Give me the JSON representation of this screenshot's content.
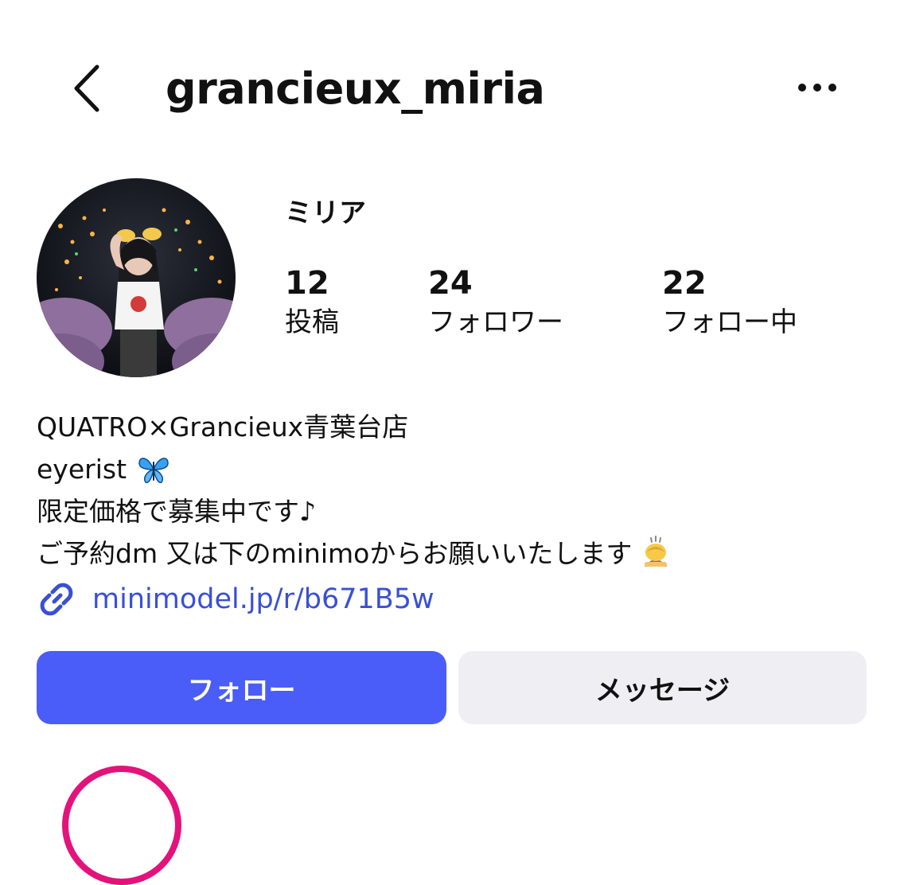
{
  "header": {
    "username": "grancieux_miria",
    "back_icon": "chevron-left-icon",
    "more_icon": "more-horizontal-icon"
  },
  "profile": {
    "display_name": "ミリア",
    "avatar_icon": "profile-photo",
    "stats": [
      {
        "number": "12",
        "label": "投稿"
      },
      {
        "number": "24",
        "label": "フォロワー"
      },
      {
        "number": "22",
        "label": "フォロー中"
      }
    ]
  },
  "bio": {
    "line1": "QUATRO×Grancieux青葉台店",
    "line2": "eyerist",
    "line2_emoji": "butterfly-emoji",
    "line3": "限定価格で募集中です♪",
    "line4": "ご予約dm 又は下のminimoからお願いいたします",
    "line4_emoji": "bowing-woman-emoji"
  },
  "link": {
    "icon": "link-icon",
    "text": "minimodel.jp/r/b671B5w"
  },
  "actions": {
    "follow_label": "フォロー",
    "message_label": "メッセージ"
  },
  "colors": {
    "accent": "#4a5df9",
    "link": "#3a4fd6",
    "secondary_button": "#efeff3",
    "story_ring": "#e3137b"
  }
}
